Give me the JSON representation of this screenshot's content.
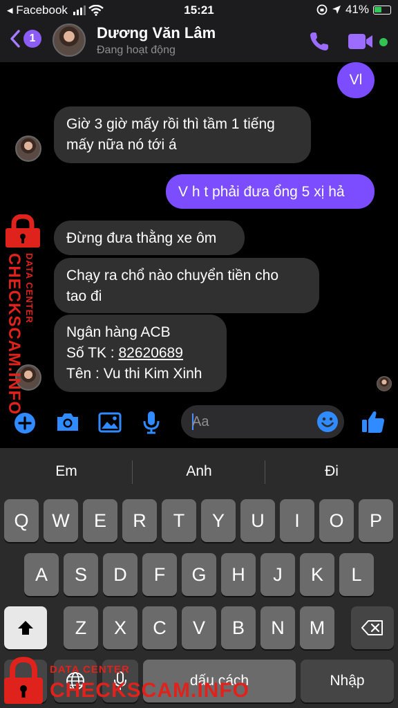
{
  "status": {
    "carrier": "◂ Facebook",
    "time": "15:21",
    "battery": "41%"
  },
  "header": {
    "back_count": "1",
    "contact_name": "Dương Văn Lâm",
    "presence": "Đang hoạt động"
  },
  "messages": {
    "m1": "Vl",
    "m2_l1": "Giờ 3 giờ mấy rồi thì tầm 1 tiếng",
    "m2_l2": "mấy nữa nó tới á",
    "m3": "V h t phải đưa ổng 5 xị hả",
    "m4": "Đừng đưa thằng xe ôm",
    "m5_l1": "Chạy ra chổ nào chuyển tiền cho",
    "m5_l2": "tao đi",
    "m6_l1": "Ngân hàng ACB",
    "m6_l2_prefix": "Số TK : ",
    "m6_l2_account": "82620689",
    "m6_l3": "Tên : Vu thi Kim Xinh"
  },
  "composer": {
    "placeholder": "Aa"
  },
  "keyboard": {
    "suggestions": [
      "Em",
      "Anh",
      "Đi"
    ],
    "row1": [
      "Q",
      "W",
      "E",
      "R",
      "T",
      "Y",
      "U",
      "I",
      "O",
      "P"
    ],
    "row2": [
      "A",
      "S",
      "D",
      "F",
      "G",
      "H",
      "J",
      "K",
      "L"
    ],
    "row3": [
      "Z",
      "X",
      "C",
      "V",
      "B",
      "N",
      "M"
    ],
    "space": "dấu cách",
    "return": "Nhập"
  },
  "watermark": {
    "label": "DATA CENTER",
    "site": "CHECKSCAM.INFO"
  },
  "colors": {
    "accent": "#8b5cf6",
    "outgoing_bubble": "#7b4dff",
    "incoming_bubble": "#303030",
    "icon_blue": "#2f8bff",
    "watermark_red": "#e0221c"
  }
}
